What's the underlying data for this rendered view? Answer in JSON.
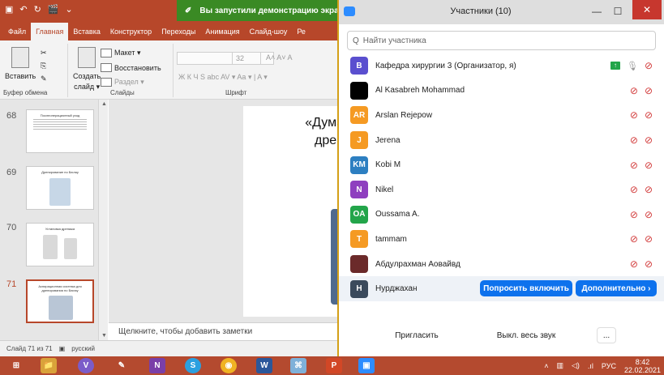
{
  "ppt": {
    "qat": [
      "▣",
      "↶",
      "↻",
      "🎬",
      "⌄"
    ],
    "banner_text": "Вы запустили демонстрацию экрана",
    "tabs": [
      "Файл",
      "Главная",
      "Вставка",
      "Конструктор",
      "Переходы",
      "Анимация",
      "Слайд-шоу",
      "Ре"
    ],
    "ribbon": {
      "paste": "Вставить",
      "create": "Создать",
      "slide": "слайд ▾",
      "layout": "Макет ▾",
      "reset": "Восстановить",
      "section": "Раздел ▾",
      "clipboard_group": "Буфер обмена",
      "slides_group": "Слайды",
      "font_group": "Шрифт",
      "font_size": "32",
      "format_row": "Ж  К  Ч  S  abc  AV ▾  Aa ▾  |  A ▾",
      "size_buttons": "A˄  A˅  A"
    },
    "thumbs": [
      {
        "num": "68",
        "title": "Послеоперационный уход"
      },
      {
        "num": "69",
        "title": "Дренирование по Бюлау"
      },
      {
        "num": "70",
        "title": "Установка дренажа"
      },
      {
        "num": "71",
        "title": "Аспирационная система для дренирования по Бюлау"
      }
    ],
    "slide_text_line1": "«Дума",
    "slide_text_line2": "дрен",
    "notes": "Щелкните, чтобы добавить заметки",
    "status_slide": "Слайд 71 из 71",
    "status_lang": "русский"
  },
  "zoom": {
    "title": "Участники (10)",
    "search_placeholder": "Найти участника",
    "participants": [
      {
        "initials": "В",
        "name": "Кафедра хирургии 3 (Организатор, я)",
        "color": "#5a4fcf",
        "host": true
      },
      {
        "initials": "",
        "name": "Al Kasabreh Mohammad",
        "color": "#000000",
        "host": false
      },
      {
        "initials": "AR",
        "name": "Arslan Rejepow",
        "color": "#f59a23",
        "host": false
      },
      {
        "initials": "J",
        "name": "Jerena",
        "color": "#f59a23",
        "host": false
      },
      {
        "initials": "KM",
        "name": "Kobi M",
        "color": "#2d7fc1",
        "host": false
      },
      {
        "initials": "N",
        "name": "Nikel",
        "color": "#8e3fbf",
        "host": false
      },
      {
        "initials": "OA",
        "name": "Oussama A.",
        "color": "#23a54a",
        "host": false
      },
      {
        "initials": "T",
        "name": "tammam",
        "color": "#f59a23",
        "host": false
      },
      {
        "initials": "",
        "name": "Абдулрахман Аовайвд",
        "color": "#6b2a2a",
        "host": false
      },
      {
        "initials": "H",
        "name": "Нурджахан",
        "color": "#3b4a5c",
        "host": false,
        "highlighted": true
      }
    ],
    "ask_unmute": "Попросить включить",
    "more": "Дополнительно ›",
    "invite": "Пригласить",
    "mute_all": "Выкл. весь звук",
    "ellipsis": "..."
  },
  "taskbar": {
    "apps": [
      {
        "name": "start",
        "label": "⊞",
        "color": "#b44a2f"
      },
      {
        "name": "explorer",
        "label": "📁",
        "color": "#d9a23a"
      },
      {
        "name": "viber",
        "label": "V",
        "color": "#7b5cc9"
      },
      {
        "name": "paint",
        "label": "✎",
        "color": "#b44a2f"
      },
      {
        "name": "onenote",
        "label": "N",
        "color": "#7a3fa8"
      },
      {
        "name": "skype",
        "label": "S",
        "color": "#2aa0e0"
      },
      {
        "name": "chrome",
        "label": "◉",
        "color": "#f0b323"
      },
      {
        "name": "word",
        "label": "W",
        "color": "#2b579a"
      },
      {
        "name": "network",
        "label": "⌘",
        "color": "#7fb1d9"
      },
      {
        "name": "powerpoint",
        "label": "P",
        "color": "#d24726"
      },
      {
        "name": "zoom",
        "label": "▣",
        "color": "#2d8cff"
      }
    ],
    "lang": "РУС",
    "time": "8:42",
    "date": "22.02.2021"
  }
}
